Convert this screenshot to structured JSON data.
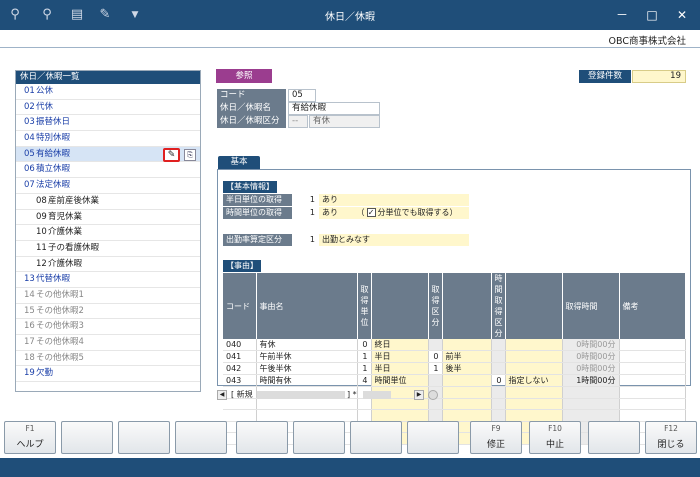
{
  "window": {
    "title": "休日／休暇",
    "company": "OBC商事株式会社",
    "controls": {
      "minimize": "－",
      "maximize": "□",
      "close": "✕"
    }
  },
  "toolbar": {
    "icons": [
      "search-plus-icon",
      "search-icon",
      "printer-icon",
      "tools-icon",
      "dropdown-icon"
    ]
  },
  "left_panel": {
    "header": "休日／休暇一覧",
    "items": [
      {
        "no": "01",
        "label": "公休"
      },
      {
        "no": "02",
        "label": "代休"
      },
      {
        "no": "03",
        "label": "振替休日"
      },
      {
        "no": "04",
        "label": "特別休暇"
      },
      {
        "no": "05",
        "label": "有給休暇"
      },
      {
        "no": "06",
        "label": "積立休暇"
      },
      {
        "no": "07",
        "label": "法定休暇"
      },
      {
        "no": "08",
        "label": "産前産後休業"
      },
      {
        "no": "09",
        "label": "育児休業"
      },
      {
        "no": "10",
        "label": "介護休業"
      },
      {
        "no": "11",
        "label": "子の看護休暇"
      },
      {
        "no": "12",
        "label": "介護休暇"
      },
      {
        "no": "13",
        "label": "代替休暇"
      },
      {
        "no": "14",
        "label": "その他休暇1"
      },
      {
        "no": "15",
        "label": "その他休暇2"
      },
      {
        "no": "16",
        "label": "その他休暇3"
      },
      {
        "no": "17",
        "label": "その他休暇4"
      },
      {
        "no": "18",
        "label": "その他休暇5"
      },
      {
        "no": "19",
        "label": "欠勤"
      }
    ]
  },
  "reference_button": "参照",
  "record_count": {
    "label": "登録件数",
    "value": "19"
  },
  "form": {
    "code": {
      "label": "コード",
      "value": "05"
    },
    "name": {
      "label": "休日／休暇名",
      "value": "有給休暇"
    },
    "category": {
      "label": "休日／休暇区分",
      "value_code": "--",
      "value_text": "有休"
    }
  },
  "tab": "基本",
  "basic_info": {
    "section_label": "【基本情報】",
    "half_day": {
      "label": "半日単位の取得",
      "num": "1",
      "text": "あり"
    },
    "hourly": {
      "label": "時間単位の取得",
      "num": "1",
      "text": "あり",
      "paren_open": "（",
      "checkbox_label": "分単位でも取得する",
      "paren_close": "）"
    },
    "attendance": {
      "label": "出勤率算定区分",
      "num": "1",
      "text": "出勤とみなす"
    }
  },
  "reasons": {
    "section_label": "【事由】",
    "columns": [
      "コード",
      "事由名",
      "取得単位",
      "",
      "取得区分",
      "",
      "時間取得区分",
      "",
      "取得時間",
      "備考"
    ],
    "rows": [
      [
        "040",
        "有休",
        "0",
        "終日",
        "",
        "",
        "",
        "",
        "0時間00分",
        ""
      ],
      [
        "041",
        "午前半休",
        "1",
        "半日",
        "0",
        "前半",
        "",
        "",
        "0時間00分",
        ""
      ],
      [
        "042",
        "午後半休",
        "1",
        "半日",
        "1",
        "後半",
        "",
        "",
        "0時間00分",
        ""
      ],
      [
        "043",
        "時間有休",
        "4",
        "時間単位",
        "",
        "",
        "0",
        "指定しない",
        "1時間00分",
        ""
      ],
      [
        "",
        "",
        "",
        "",
        "",
        "",
        "",
        "",
        "",
        ""
      ],
      [
        "",
        "",
        "",
        "",
        "",
        "",
        "",
        "",
        "",
        ""
      ],
      [
        "",
        "",
        "",
        "",
        "",
        "",
        "",
        "",
        "",
        ""
      ],
      [
        "",
        "",
        "",
        "",
        "",
        "",
        "",
        "",
        "",
        ""
      ],
      [
        "",
        "",
        "",
        "",
        "",
        "",
        "",
        "",
        "",
        ""
      ]
    ]
  },
  "status": {
    "new_prefix": "[ 新規",
    "suffix": "] *"
  },
  "function_keys": [
    {
      "key": "F1",
      "label": "ヘルプ"
    },
    {
      "key": "",
      "label": ""
    },
    {
      "key": "",
      "label": ""
    },
    {
      "key": "",
      "label": ""
    },
    {
      "key": "",
      "label": ""
    },
    {
      "key": "",
      "label": ""
    },
    {
      "key": "",
      "label": ""
    },
    {
      "key": "",
      "label": ""
    },
    {
      "key": "F9",
      "label": "修正"
    },
    {
      "key": "F10",
      "label": "中止"
    },
    {
      "key": "",
      "label": ""
    },
    {
      "key": "F12",
      "label": "閉じる"
    }
  ]
}
